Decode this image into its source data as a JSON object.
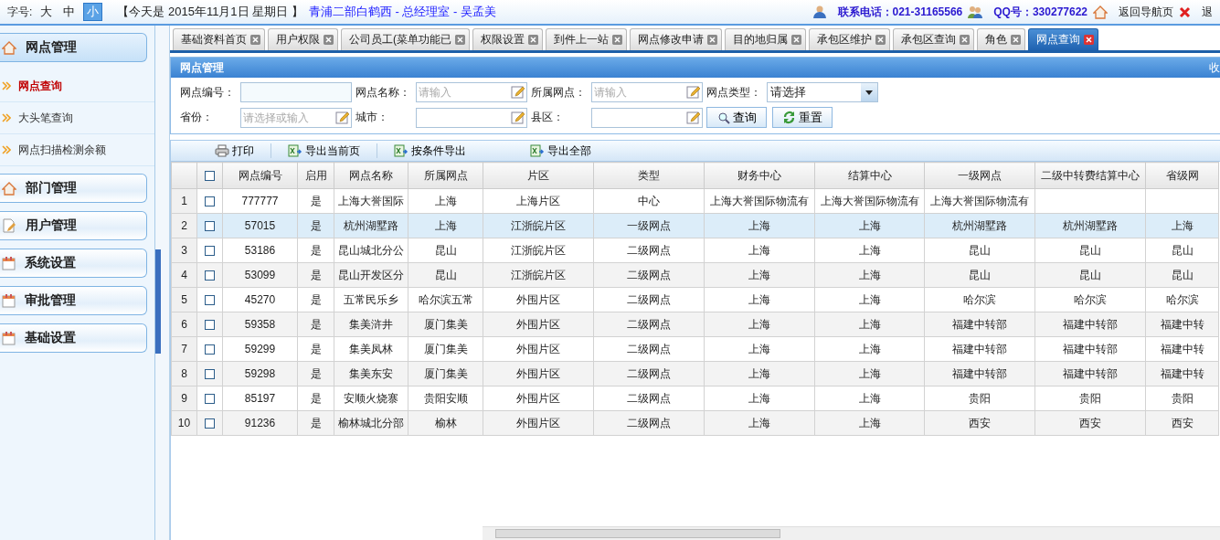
{
  "top_bar": {
    "font_size_label": "字号:",
    "font_sizes": [
      {
        "label": "大",
        "selected": false
      },
      {
        "label": "中",
        "selected": false
      },
      {
        "label": "小",
        "selected": true
      }
    ],
    "date": "【今天是 2015年11月1日 星期日 】",
    "user": "青浦二部白鹤西 - 总经理室 - 吴孟美",
    "phone": "联系电话：021-31165566",
    "qq": "QQ号：330277622",
    "links": [
      {
        "label": "返回导航页",
        "kind": "home"
      },
      {
        "label": "退",
        "kind": "exit"
      }
    ]
  },
  "sidebar": {
    "groups": [
      {
        "label": "网点管理",
        "kind": "home",
        "expanded": true,
        "items": [
          {
            "label": "网点查询",
            "selected": true
          },
          {
            "label": "大头笔查询",
            "selected": false
          },
          {
            "label": "网点扫描检测余额",
            "selected": false
          }
        ]
      },
      {
        "label": "部门管理",
        "kind": "home",
        "expanded": false
      },
      {
        "label": "用户管理",
        "kind": "edit",
        "expanded": false
      },
      {
        "label": "系统设置",
        "kind": "calendar",
        "expanded": false
      },
      {
        "label": "审批管理",
        "kind": "calendar",
        "expanded": false
      },
      {
        "label": "基础设置",
        "kind": "calendar",
        "expanded": false
      }
    ]
  },
  "tabs": [
    {
      "label": "基础资料首页",
      "selected": false
    },
    {
      "label": "用户权限",
      "selected": false
    },
    {
      "label": "公司员工(菜单功能已",
      "selected": false
    },
    {
      "label": "权限设置",
      "selected": false
    },
    {
      "label": "到件上一站",
      "selected": false
    },
    {
      "label": "网点修改申请",
      "selected": false
    },
    {
      "label": "目的地归属",
      "selected": false
    },
    {
      "label": "承包区维护",
      "selected": false
    },
    {
      "label": "承包区查询",
      "selected": false
    },
    {
      "label": "角色",
      "selected": false
    },
    {
      "label": "网点查询",
      "selected": true
    }
  ],
  "panel": {
    "title": "网点管理",
    "collapse": "收"
  },
  "filters": [
    [
      {
        "label": "网点编号：",
        "kind": "plain"
      },
      {
        "label": "网点名称：",
        "kind": "edit",
        "placeholder": "请输入"
      },
      {
        "label": "所属网点：",
        "kind": "edit",
        "placeholder": "请输入"
      },
      {
        "label": "网点类型：",
        "kind": "select",
        "value": "请选择"
      }
    ],
    [
      {
        "label": "省份：",
        "kind": "edit",
        "placeholder": "请选择或输入"
      },
      {
        "label": "城市：",
        "kind": "edit"
      },
      {
        "label": "县区：",
        "kind": "edit"
      }
    ]
  ],
  "buttons": [
    {
      "label": "查询",
      "kind": "search"
    },
    {
      "label": "重置",
      "kind": "reset"
    }
  ],
  "toolbar": [
    {
      "label": "打印",
      "kind": "print"
    },
    {
      "label": "导出当前页",
      "kind": "excel"
    },
    {
      "label": "按条件导出",
      "kind": "excel"
    },
    {
      "label": "导出全部",
      "kind": "excel"
    }
  ],
  "table": {
    "columns": [
      {
        "kind": "rownum"
      },
      {
        "kind": "checkbox",
        "checked": false
      },
      {
        "kind": "text",
        "label": "网点编号"
      },
      {
        "kind": "text",
        "label": "启用"
      },
      {
        "kind": "text",
        "label": "网点名称"
      },
      {
        "kind": "text",
        "label": "所属网点"
      },
      {
        "kind": "text",
        "label": "片区"
      },
      {
        "kind": "text",
        "label": "类型"
      },
      {
        "kind": "text",
        "label": "财务中心"
      },
      {
        "kind": "text",
        "label": "结算中心"
      },
      {
        "kind": "text",
        "label": "一级网点"
      },
      {
        "kind": "text",
        "label": "二级中转费结算中心"
      },
      {
        "kind": "text",
        "label": "省级网"
      }
    ],
    "rows": [
      {
        "selected": false,
        "cells": [
          "1",
          {
            "kind": "checkbox",
            "checked": false
          },
          "777777",
          "是",
          "上海大誉国际",
          "上海",
          "上海片区",
          "中心",
          "上海大誉国际物流有",
          "上海大誉国际物流有",
          "上海大誉国际物流有",
          "",
          ""
        ]
      },
      {
        "selected": true,
        "cells": [
          "2",
          {
            "kind": "checkbox",
            "checked": false
          },
          "57015",
          "是",
          "杭州湖墅路",
          "上海",
          "江浙皖片区",
          "一级网点",
          "上海",
          "上海",
          "杭州湖墅路",
          "杭州湖墅路",
          "上海"
        ]
      },
      {
        "selected": false,
        "cells": [
          "3",
          {
            "kind": "checkbox",
            "checked": false
          },
          "53186",
          "是",
          "昆山城北分公",
          "昆山",
          "江浙皖片区",
          "二级网点",
          "上海",
          "上海",
          "昆山",
          "昆山",
          "昆山"
        ]
      },
      {
        "selected": false,
        "cells": [
          "4",
          {
            "kind": "checkbox",
            "checked": false
          },
          "53099",
          "是",
          "昆山开发区分",
          "昆山",
          "江浙皖片区",
          "二级网点",
          "上海",
          "上海",
          "昆山",
          "昆山",
          "昆山"
        ]
      },
      {
        "selected": false,
        "cells": [
          "5",
          {
            "kind": "checkbox",
            "checked": false
          },
          "45270",
          "是",
          "五常民乐乡",
          "哈尔滨五常",
          "外围片区",
          "二级网点",
          "上海",
          "上海",
          "哈尔滨",
          "哈尔滨",
          "哈尔滨"
        ]
      },
      {
        "selected": false,
        "cells": [
          "6",
          {
            "kind": "checkbox",
            "checked": false
          },
          "59358",
          "是",
          "集美浒井",
          "厦门集美",
          "外围片区",
          "二级网点",
          "上海",
          "上海",
          "福建中转部",
          "福建中转部",
          "福建中转"
        ]
      },
      {
        "selected": false,
        "cells": [
          "7",
          {
            "kind": "checkbox",
            "checked": false
          },
          "59299",
          "是",
          "集美凤林",
          "厦门集美",
          "外围片区",
          "二级网点",
          "上海",
          "上海",
          "福建中转部",
          "福建中转部",
          "福建中转"
        ]
      },
      {
        "selected": false,
        "cells": [
          "8",
          {
            "kind": "checkbox",
            "checked": false
          },
          "59298",
          "是",
          "集美东安",
          "厦门集美",
          "外围片区",
          "二级网点",
          "上海",
          "上海",
          "福建中转部",
          "福建中转部",
          "福建中转"
        ]
      },
      {
        "selected": false,
        "cells": [
          "9",
          {
            "kind": "checkbox",
            "checked": false
          },
          "85197",
          "是",
          "安顺火烧寨",
          "贵阳安顺",
          "外围片区",
          "二级网点",
          "上海",
          "上海",
          "贵阳",
          "贵阳",
          "贵阳"
        ]
      },
      {
        "selected": false,
        "cells": [
          "10",
          {
            "kind": "checkbox",
            "checked": false
          },
          "91236",
          "是",
          "榆林城北分部",
          "榆林",
          "外围片区",
          "二级网点",
          "上海",
          "上海",
          "西安",
          "西安",
          "西安"
        ]
      }
    ]
  }
}
